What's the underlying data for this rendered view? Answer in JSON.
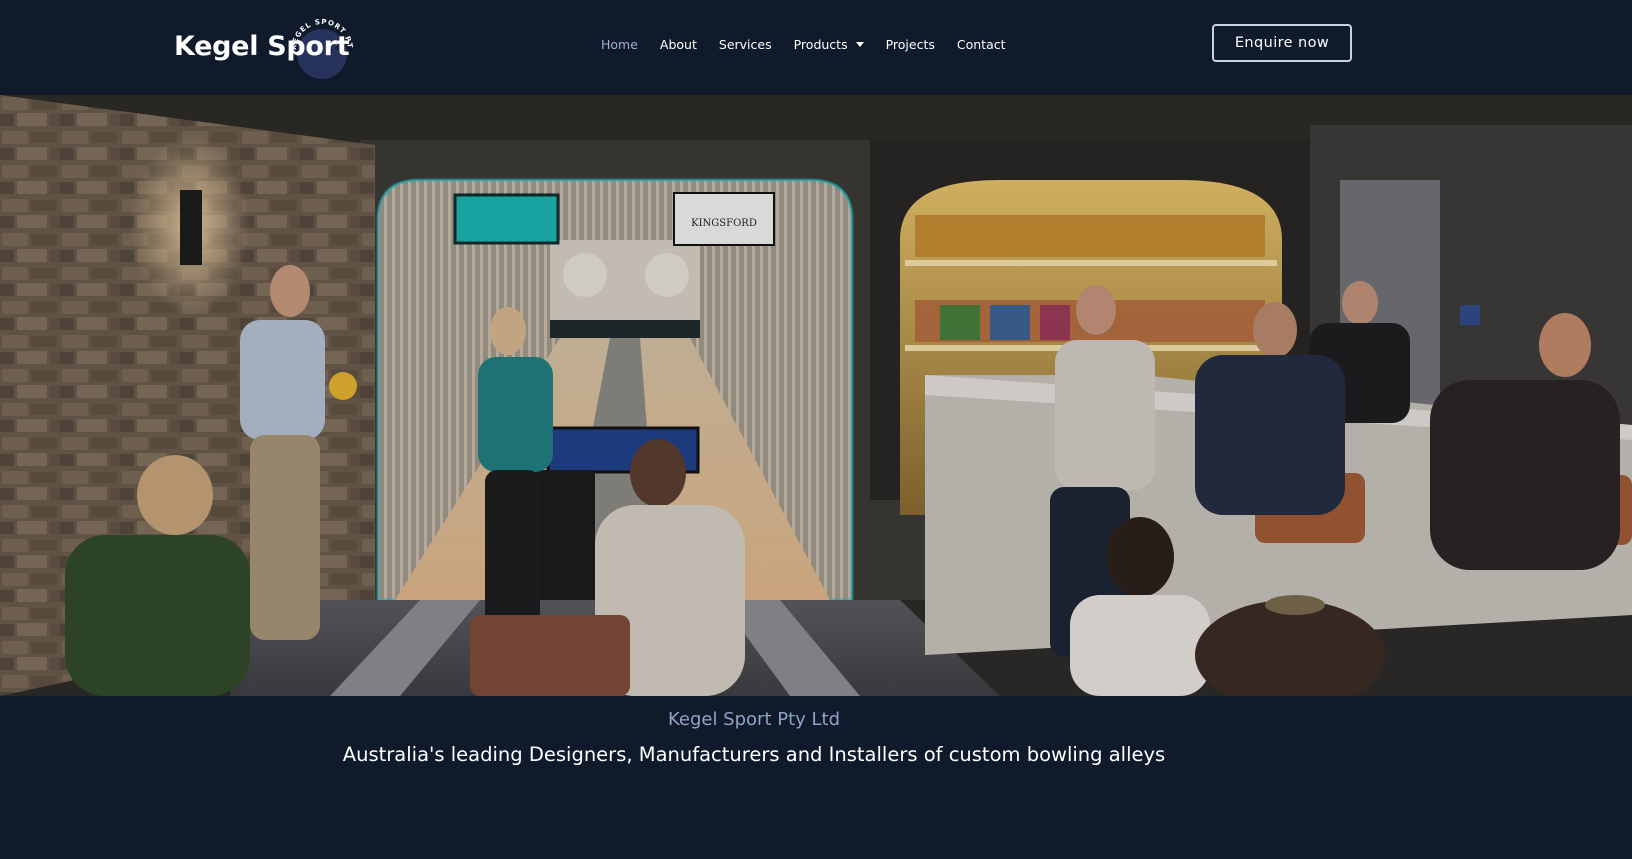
{
  "header": {
    "logo": {
      "text": "Kegel Sport",
      "badge_text": "KEGEL SPORT PTY LTD"
    },
    "nav": [
      {
        "label": "Home",
        "active": true
      },
      {
        "label": "About"
      },
      {
        "label": "Services"
      },
      {
        "label": "Products",
        "has_dropdown": true
      },
      {
        "label": "Projects"
      },
      {
        "label": "Contact"
      }
    ],
    "cta_label": "Enquire now"
  },
  "hero": {
    "image_alt": "Bowling alley and bar interior",
    "lane_screen_text": "KINGSFORD"
  },
  "caption": {
    "company_name": "Kegel Sport Pty Ltd",
    "tagline": "Australia's leading Designers, Manufacturers and Installers of custom bowling alleys"
  },
  "colors": {
    "background": "#0f1a2b",
    "nav_active": "#9fb2d2",
    "company_name": "#8fa3c4",
    "text": "#ffffff"
  }
}
